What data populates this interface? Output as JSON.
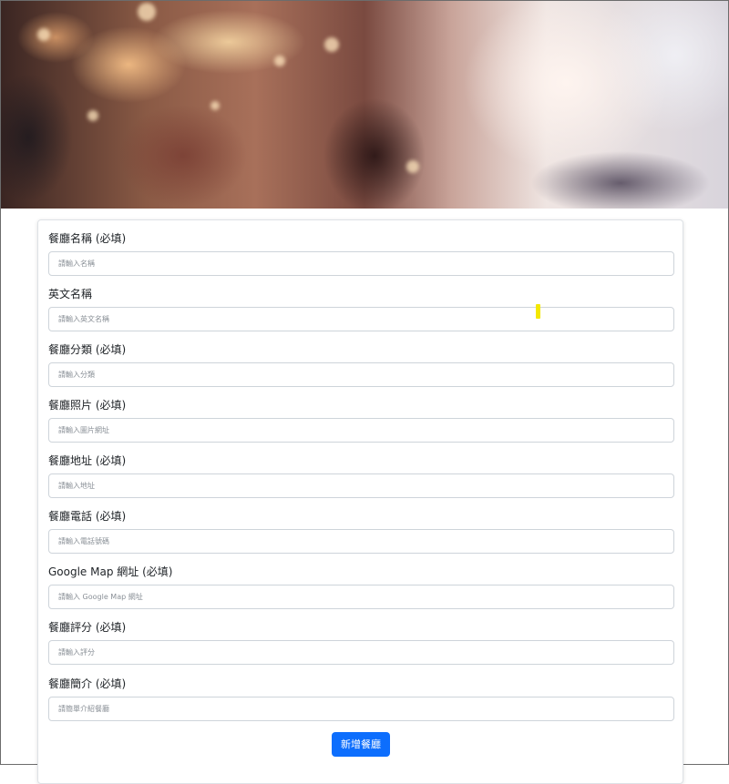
{
  "form": {
    "fields": [
      {
        "label": "餐廳名稱 (必填)",
        "placeholder": "請輸入名稱"
      },
      {
        "label": "英文名稱",
        "placeholder": "請輸入英文名稱"
      },
      {
        "label": "餐廳分類 (必填)",
        "placeholder": "請輸入分類"
      },
      {
        "label": "餐廳照片 (必填)",
        "placeholder": "請輸入圖片網址"
      },
      {
        "label": "餐廳地址 (必填)",
        "placeholder": "請輸入地址"
      },
      {
        "label": "餐廳電話 (必填)",
        "placeholder": "請輸入電話號碼"
      },
      {
        "label": "Google Map 網址 (必填)",
        "placeholder": "請輸入 Google Map 網址"
      },
      {
        "label": "餐廳評分 (必填)",
        "placeholder": "請輸入評分"
      },
      {
        "label": "餐廳簡介 (必填)",
        "placeholder": "請簡單介紹餐廳"
      }
    ],
    "submit_label": "新增餐廳"
  },
  "colors": {
    "primary": "#0d6efd",
    "input_border": "#ced4da",
    "card_border": "#dee2e6",
    "cursor_highlight": "#f4e800"
  }
}
